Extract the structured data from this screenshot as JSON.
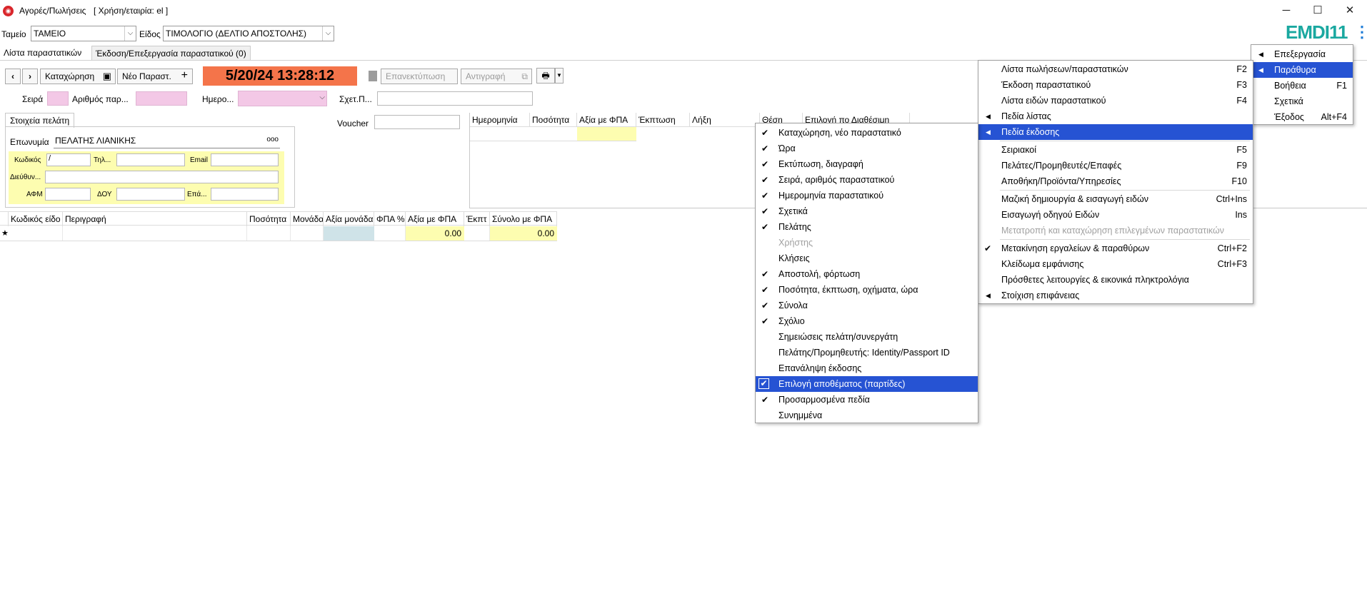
{
  "window": {
    "title": "Αγορές/Πωλήσεις",
    "subtitle": "[ Χρήση/εταιρία: el ]",
    "minimize": "─",
    "maximize": "☐",
    "close": "✕",
    "logo": "EMDI11",
    "more": "⋮"
  },
  "toolbar": {
    "tameio_label": "Ταμείο",
    "tameio_value": "ΤΑΜΕΙΟ",
    "eidos_label": "Είδος",
    "eidos_value": "ΤΙΜΟΛΟΓΙΟ (ΔΕΛΤΙΟ ΑΠΟΣΤΟΛΗΣ)"
  },
  "tabs": [
    "Λίστα παραστατικών",
    "Έκδοση/Επεξεργασία παραστατικού (0)"
  ],
  "actions": {
    "prev": "‹",
    "next": "›",
    "save": "Καταχώρηση",
    "new": "Νέο Παραστ.",
    "datetime": "5/20/24 13:28:12",
    "reprint": "Επανεκτύπωση",
    "copy": "Αντιγραφή"
  },
  "fields": {
    "seira": "Σειρά",
    "arithmos": "Αριθμός παρ...",
    "imero": "Ημερο...",
    "sxet": "Σχετ.Π...",
    "voucher": "Voucher"
  },
  "customer": {
    "tab": "Στοιχεία πελάτη",
    "eponymia_label": "Επωνυμία",
    "eponymia_value": "ΠΕΛΑΤΗΣ ΛΙΑΝΙΚΗΣ",
    "more": "ooo",
    "kodikos": "Κωδικός",
    "kodikos_value": "/",
    "til": "Τηλ...",
    "email": "Email",
    "dieuth": "Διεύθυν...",
    "afm": "ΑΦΜ",
    "doy": "ΔΟΥ",
    "epa": "Επά..."
  },
  "lots_headers": [
    "Ημερομηνία",
    "Ποσότητα",
    "Αξία με ΦΠΑ",
    "Έκπτωση",
    "Λήξη",
    "Θέση",
    "Επιλογή πο Διαθέσιμη"
  ],
  "lines_headers": [
    "Κωδικός είδο",
    "Περιγραφή",
    "Ποσότητα",
    "Μονάδα",
    "Αξία μονάδα",
    "ΦΠΑ %",
    "Αξία με ΦΠΑ",
    "Έκπτ",
    "Σύνολο με ΦΠΑ"
  ],
  "lines_row": {
    "marker": "★",
    "value_vat": "0.00",
    "total_vat": "0.00"
  },
  "menu_main": [
    {
      "label": "Επεξεργασία",
      "sub": true,
      "hl": false
    },
    {
      "label": "Παράθυρα",
      "sub": true,
      "hl": true
    },
    {
      "label": "Βοήθεια",
      "sc": "F1"
    },
    {
      "label": "Σχετικά"
    },
    {
      "label": "Έξοδος",
      "sc": "Alt+F4"
    }
  ],
  "menu_windows": [
    {
      "label": "Λίστα πωλήσεων/παραστατικών",
      "sc": "F2"
    },
    {
      "label": "Έκδοση παραστατικού",
      "sc": "F3"
    },
    {
      "label": "Λίστα ειδών παραστατικού",
      "sc": "F4"
    },
    {
      "label": "Πεδία λίστας",
      "sub": true
    },
    {
      "label": "Πεδία έκδοσης",
      "sub": true,
      "hl": true
    },
    {
      "sep": true
    },
    {
      "label": "Σειριακοί",
      "sc": "F5"
    },
    {
      "label": "Πελάτες/Προμηθευτές/Επαφές",
      "sc": "F9"
    },
    {
      "label": "Αποθήκη/Προϊόντα/Υπηρεσίες",
      "sc": "F10"
    },
    {
      "sep": true
    },
    {
      "label": "Μαζική δημιουργία & εισαγωγή ειδών",
      "sc": "Ctrl+Ins"
    },
    {
      "label": "Εισαγωγή οδηγού Ειδών",
      "sc": "Ins"
    },
    {
      "label": "Μετατροπή και καταχώρηση επιλεγμένων παραστατικών",
      "dis": true
    },
    {
      "sep": true
    },
    {
      "label": "Μετακίνηση εργαλείων & παραθύρων",
      "sc": "Ctrl+F2",
      "chk": true
    },
    {
      "label": "Κλείδωμα εμφάνισης",
      "sc": "Ctrl+F3"
    },
    {
      "label": "Πρόσθετες λειτουργίες & εικονικά πληκτρολόγια"
    },
    {
      "label": "Στοίχιση επιφάνειας",
      "sub": true
    }
  ],
  "menu_fields": [
    {
      "label": "Καταχώρηση, νέο παραστατικό",
      "chk": true
    },
    {
      "label": "Ώρα",
      "chk": true
    },
    {
      "label": "Εκτύπωση, διαγραφή",
      "chk": true
    },
    {
      "label": "Σειρά, αριθμός παραστατικού",
      "chk": true
    },
    {
      "label": "Ημερομηνία παραστατικού",
      "chk": true
    },
    {
      "label": "Σχετικά",
      "chk": true
    },
    {
      "label": "Πελάτης",
      "chk": true
    },
    {
      "label": "Χρήστης",
      "dis": true
    },
    {
      "label": "Κλήσεις"
    },
    {
      "label": "Αποστολή, φόρτωση",
      "chk": true
    },
    {
      "label": "Ποσότητα, έκπτωση, οχήματα, ώρα",
      "chk": true
    },
    {
      "label": "Σύνολα",
      "chk": true
    },
    {
      "label": "Σχόλιο",
      "chk": true
    },
    {
      "label": "Σημειώσεις πελάτη/συνεργάτη"
    },
    {
      "label": "Πελάτης/Προμηθευτής: Identity/Passport ID"
    },
    {
      "label": "Επανάληψη έκδοσης"
    },
    {
      "label": "Επιλογή αποθέματος (παρτίδες)",
      "chk": true,
      "hl": true
    },
    {
      "label": "Προσαρμοσμένα πεδία",
      "chk": true
    },
    {
      "label": "Συνημμένα"
    }
  ],
  "colors": {
    "datetime_bg": "#f4744a",
    "menu_highlight": "#2653d3",
    "pink": "#f3c8e6",
    "yellow": "#fdfdb0",
    "logo": "#1aa8a0"
  }
}
